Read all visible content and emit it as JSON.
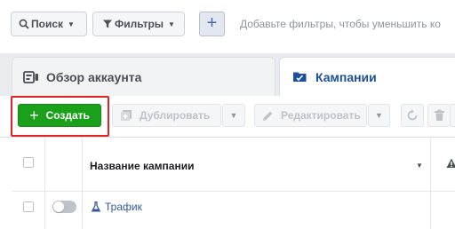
{
  "filters": {
    "search_label": "Поиск",
    "filters_label": "Фильтры",
    "add_symbol": "+",
    "hint": "Добавьте фильтры, чтобы уменьшить ко"
  },
  "tabs": [
    {
      "label": "Обзор аккаунта",
      "icon": "account-overview-icon",
      "active": false
    },
    {
      "label": "Кампании",
      "icon": "folder-icon",
      "active": true
    }
  ],
  "toolbar": {
    "create_label": "Создать",
    "duplicate_label": "Дублировать",
    "edit_label": "Редактировать"
  },
  "table": {
    "columns": [
      "Название кампании"
    ],
    "rows": [
      {
        "name": "Трафик",
        "enabled": false,
        "icon": "flask-icon"
      }
    ]
  },
  "colors": {
    "create_button": "#1aa01a",
    "highlight": "#e02424",
    "link": "#365899",
    "active_tab_text": "#1c4f9c"
  }
}
